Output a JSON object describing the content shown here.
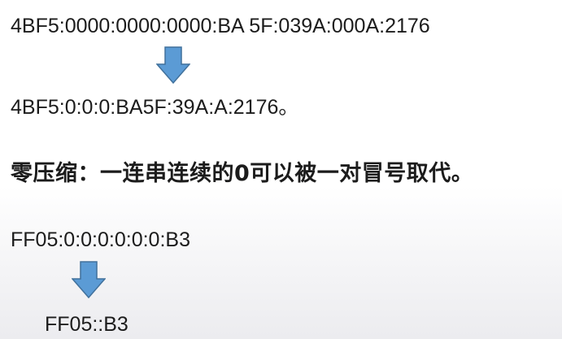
{
  "slide": {
    "line1": "4BF5:0000:0000:0000:BA 5F:039A:000A:2176",
    "line2": "4BF5:0:0:0:BA5F:39A:A:2176。",
    "heading": "零压缩：一连串连续的0可以被一对冒号取代。",
    "example_full": "FF05:0:0:0:0:0:0:B3",
    "example_compressed": "FF05::B3"
  },
  "colors": {
    "arrow_fill": "#5b9bd5",
    "arrow_stroke": "#41719c",
    "text": "#1c1c1c"
  },
  "icons": {
    "arrow": "down-arrow-icon"
  }
}
